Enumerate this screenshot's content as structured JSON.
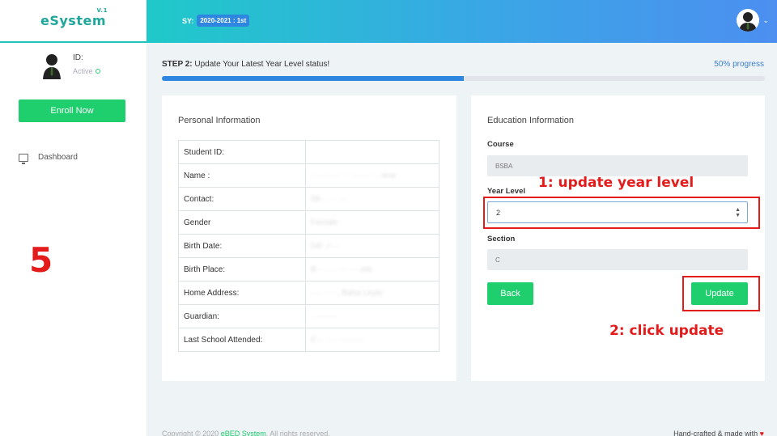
{
  "header": {
    "brand": "eSystem",
    "brand_version": "V.1",
    "sy_label": "SY:",
    "sy_value": "2020-2021 : 1st",
    "user_menu_caret": "⌄"
  },
  "sidebar": {
    "id_label": "ID:",
    "status": "Active",
    "enroll_button": "Enroll Now",
    "nav": [
      {
        "label": "Dashboard",
        "icon": "monitor-icon"
      }
    ]
  },
  "annotation": {
    "step_number": "5",
    "note1": "1: update year level",
    "note2": "2: click update"
  },
  "step": {
    "prefix": "STEP 2:",
    "text": "Update Your Latest Year Level status!",
    "progress_label": "50% progress",
    "progress_fraction": 0.5
  },
  "personal": {
    "title": "Personal Information",
    "rows": [
      {
        "label": "Student ID:",
        "value": ""
      },
      {
        "label": "Name :",
        "value": "··········· ·· ········ ···tina"
      },
      {
        "label": "Contact:",
        "value": "09·· ··· ····"
      },
      {
        "label": "Gender",
        "value": "Female"
      },
      {
        "label": "Birth Date:",
        "value": "04/··/····"
      },
      {
        "label": "Birth Place:",
        "value": "B········ ··· ····ete"
      },
      {
        "label": "Home Address:",
        "value": "···· ·····, Baha Leyte"
      },
      {
        "label": "Guardian:",
        "value": "··········"
      },
      {
        "label": "Last School Attended:",
        "value": "C··· ···· ·········"
      }
    ]
  },
  "education": {
    "title": "Education Information",
    "course_label": "Course",
    "course_value": "BSBA",
    "year_label": "Year Level",
    "year_value": "2",
    "section_label": "Section",
    "section_value": "C",
    "back_button": "Back",
    "update_button": "Update"
  },
  "footer": {
    "copyright_prefix": "Copyright © 2020",
    "brand": "eBED System",
    "copyright_suffix": ". All rights reserved.",
    "right_text": "Hand-crafted & made with",
    "heart": "♥"
  },
  "colors": {
    "accent_green": "#1fcf6e",
    "accent_blue": "#2e86e0",
    "annotation_red": "#e31b1b"
  }
}
